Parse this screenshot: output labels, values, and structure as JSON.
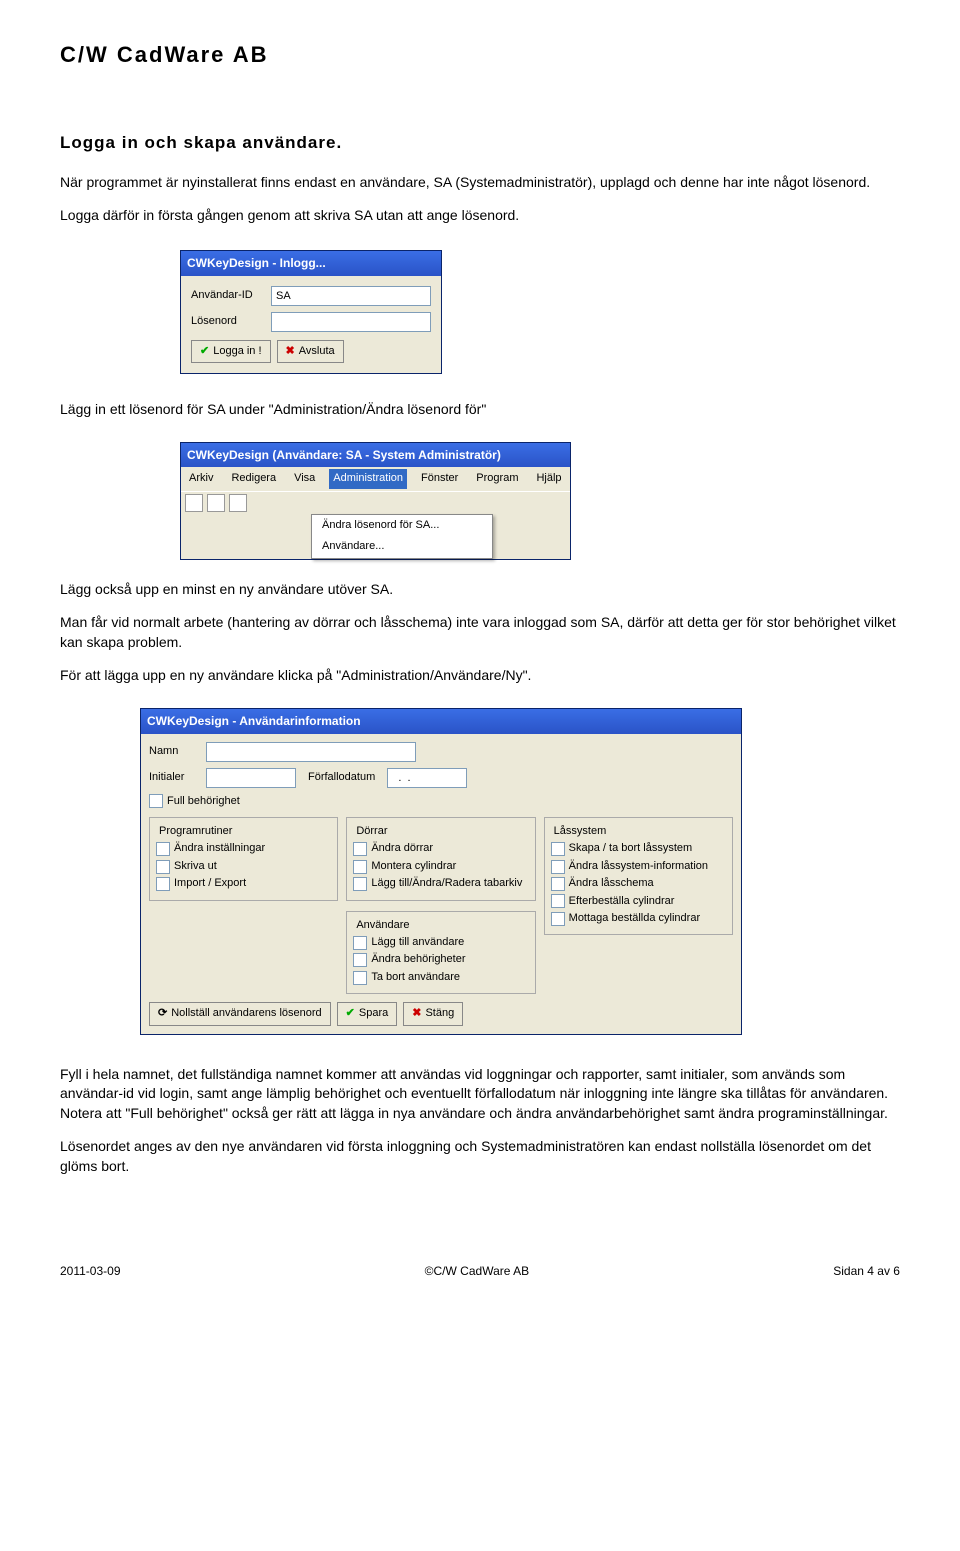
{
  "header": "C/W CadWare AB",
  "section_title": "Logga in och skapa användare.",
  "p1": "När programmet är nyinstallerat finns endast en användare, SA (Systemadministratör), upplagd och denne har inte något lösenord.",
  "p2": "Logga därför in första gången genom att skriva SA utan att ange lösenord.",
  "login": {
    "title": "CWKeyDesign - Inlogg...",
    "userid_label": "Användar-ID",
    "password_label": "Lösenord",
    "userid_value": "SA",
    "login_btn": "Logga in !",
    "quit_btn": "Avsluta"
  },
  "p3": "Lägg in ett lösenord för SA under \"Administration/Ändra lösenord för\"",
  "appwin": {
    "title": "CWKeyDesign   (Användare: SA - System Administratör)",
    "menu": [
      "Arkiv",
      "Redigera",
      "Visa",
      "Administration",
      "Fönster",
      "Program",
      "Hjälp"
    ],
    "submenu": [
      "Ändra lösenord för SA...",
      "Användare..."
    ]
  },
  "p4": "Lägg också upp en minst en ny användare utöver SA.",
  "p5": "Man får vid normalt arbete (hantering av dörrar och låsschema) inte vara inloggad som SA, därför att detta ger för stor behörighet vilket kan skapa problem.",
  "p6": "För att lägga upp en ny användare klicka på \"Administration/Användare/Ny\".",
  "userinfo": {
    "title": "CWKeyDesign - Användarinformation",
    "name_label": "Namn",
    "initials_label": "Initialer",
    "expiry_label": "Förfallodatum",
    "expiry_value": "  .  .",
    "full_perm": "Full behörighet",
    "group_prog": "Programrutiner",
    "prog_items": [
      "Ändra inställningar",
      "Skriva ut",
      "Import / Export"
    ],
    "group_door": "Dörrar",
    "door_items": [
      "Ändra dörrar",
      "Montera cylindrar",
      "Lägg till/Ändra/Radera tabarkiv"
    ],
    "group_user": "Användare",
    "user_items": [
      "Lägg till användare",
      "Ändra behörigheter",
      "Ta bort användare"
    ],
    "group_lock": "Låssystem",
    "lock_items": [
      "Skapa / ta bort låssystem",
      "Ändra låssystem-information",
      "Ändra låsschema",
      "Efterbeställa cylindrar",
      "Mottaga beställda cylindrar"
    ],
    "reset_btn": "Nollställ användarens lösenord",
    "save_btn": "Spara",
    "close_btn": "Stäng"
  },
  "p7": "Fyll i hela namnet, det fullständiga namnet kommer att användas vid loggningar och rapporter, samt initialer, som används som användar-id vid login, samt ange lämplig behörighet och eventuellt förfallodatum när inloggning inte längre ska tillåtas för användaren. Notera att \"Full behörighet\" också ger rätt att lägga in nya användare och ändra användarbehörighet samt ändra programinställningar.",
  "p8": "Lösenordet anges av den nye användaren vid första inloggning och Systemadministratören kan endast nollställa lösenordet om det glöms bort.",
  "footer": {
    "date": "2011-03-09",
    "copyright": "©C/W CadWare AB",
    "page": "Sidan 4 av 6"
  }
}
